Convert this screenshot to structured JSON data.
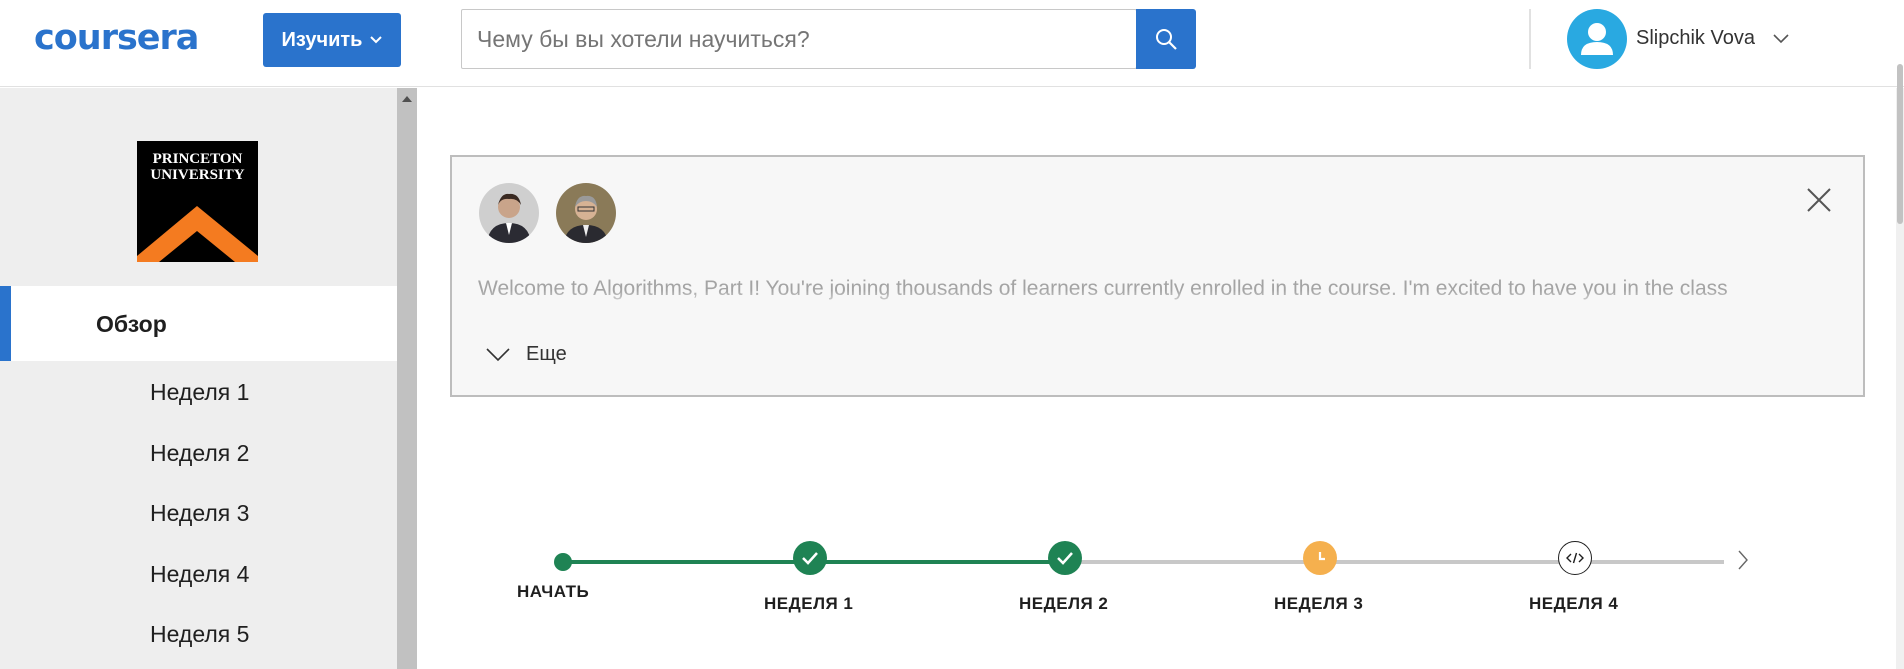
{
  "header": {
    "logo": "coursera",
    "explore_label": "Изучить",
    "search_placeholder": "Чему бы вы хотели научиться?",
    "user_name": "Slipchik Vova"
  },
  "sidebar": {
    "university_logo_text": "PRINCETON UNIVERSITY",
    "overview_label": "Обзор",
    "weeks": [
      "Неделя 1",
      "Неделя 2",
      "Неделя 3",
      "Неделя 4",
      "Неделя 5"
    ]
  },
  "message": {
    "text": "Welcome to Algorithms, Part I! You're joining thousands of learners currently enrolled in the course. I'm excited to have you in the class",
    "more_label": "Еще"
  },
  "timeline": {
    "start_label": "НАЧАТЬ",
    "nodes": [
      {
        "label": "НЕДЕЛЯ 1",
        "status": "completed"
      },
      {
        "label": "НЕДЕЛЯ 2",
        "status": "completed"
      },
      {
        "label": "НЕДЕЛЯ 3",
        "status": "in-progress"
      },
      {
        "label": "НЕДЕЛЯ 4",
        "status": "upcoming"
      }
    ]
  },
  "colors": {
    "brand_blue": "#2a73cc",
    "success_green": "#1f8354",
    "progress_orange": "#f5b04e",
    "avatar_blue": "#29a9e1"
  }
}
